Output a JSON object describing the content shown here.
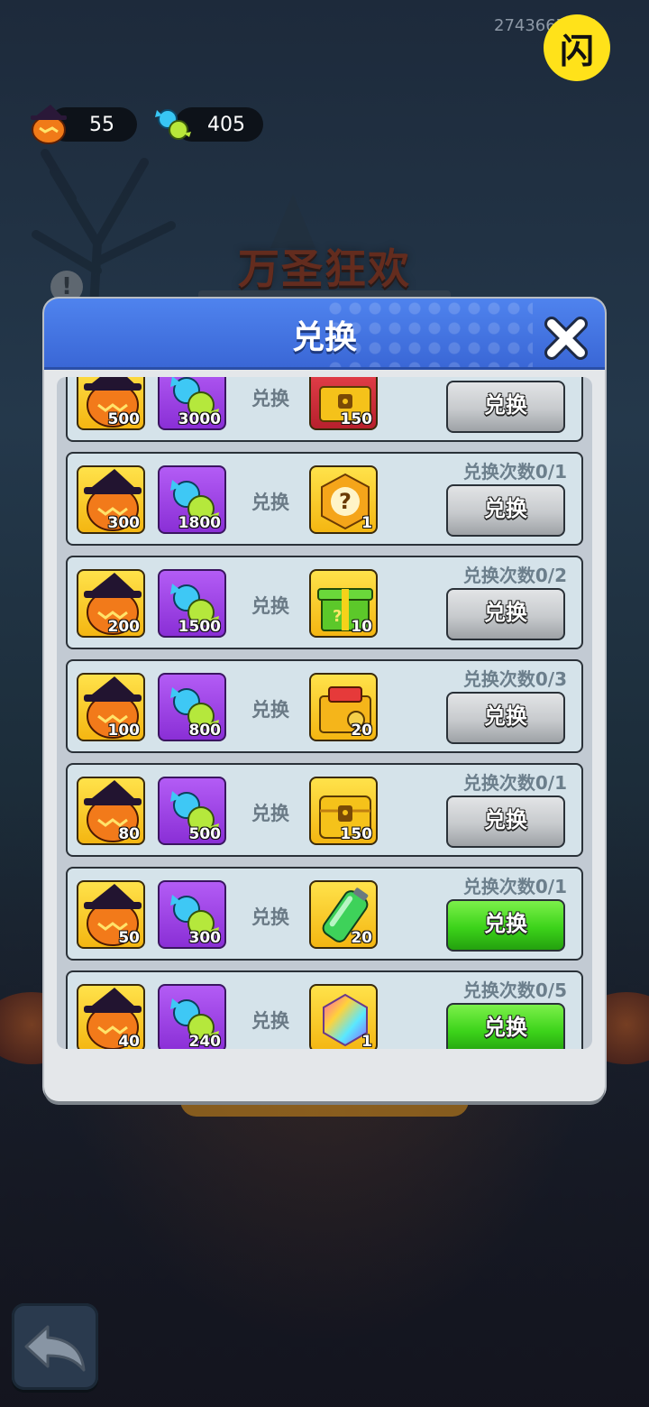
{
  "top_bar": {
    "id_text": "2743667 3.4",
    "logo_glyph": "闪"
  },
  "resources": [
    {
      "icon": "witch-pumpkin-icon",
      "value": "55"
    },
    {
      "icon": "candy-icon",
      "value": "405"
    }
  ],
  "background": {
    "event_title": "万圣狂欢"
  },
  "panel": {
    "title": "兑换",
    "close_icon": "close-x-icon"
  },
  "rows": [
    {
      "pumpkin_qty": "500",
      "candy_qty": "3000",
      "exchange_label": "兑换",
      "reward_icon": "red-locked-chest-icon",
      "reward_qty": "150",
      "count_text": "",
      "button_label": "兑换",
      "button_state": "gray"
    },
    {
      "pumpkin_qty": "300",
      "candy_qty": "1800",
      "exchange_label": "兑换",
      "reward_icon": "mystery-question-badge-icon",
      "reward_qty": "1",
      "count_text": "兑换次数0/1",
      "button_label": "兑换",
      "button_state": "gray"
    },
    {
      "pumpkin_qty": "200",
      "candy_qty": "1500",
      "exchange_label": "兑换",
      "reward_icon": "green-mystery-gift-icon",
      "reward_qty": "10",
      "count_text": "兑换次数0/2",
      "button_label": "兑换",
      "button_state": "gray"
    },
    {
      "pumpkin_qty": "100",
      "candy_qty": "800",
      "exchange_label": "兑换",
      "reward_icon": "puzzle-chest-icon",
      "reward_qty": "20",
      "count_text": "兑换次数0/3",
      "button_label": "兑换",
      "button_state": "gray"
    },
    {
      "pumpkin_qty": "80",
      "candy_qty": "500",
      "exchange_label": "兑换",
      "reward_icon": "gold-locked-chest-icon",
      "reward_qty": "150",
      "count_text": "兑换次数0/1",
      "button_label": "兑换",
      "button_state": "gray"
    },
    {
      "pumpkin_qty": "50",
      "candy_qty": "300",
      "exchange_label": "兑换",
      "reward_icon": "energy-battery-icon",
      "reward_qty": "20",
      "count_text": "兑换次数0/1",
      "button_label": "兑换",
      "button_state": "green"
    },
    {
      "pumpkin_qty": "40",
      "candy_qty": "240",
      "exchange_label": "兑换",
      "reward_icon": "rainbow-gem-icon",
      "reward_qty": "1",
      "count_text": "兑换次数0/5",
      "button_label": "兑换",
      "button_state": "green"
    }
  ],
  "back_button_icon": "back-arrow-icon"
}
